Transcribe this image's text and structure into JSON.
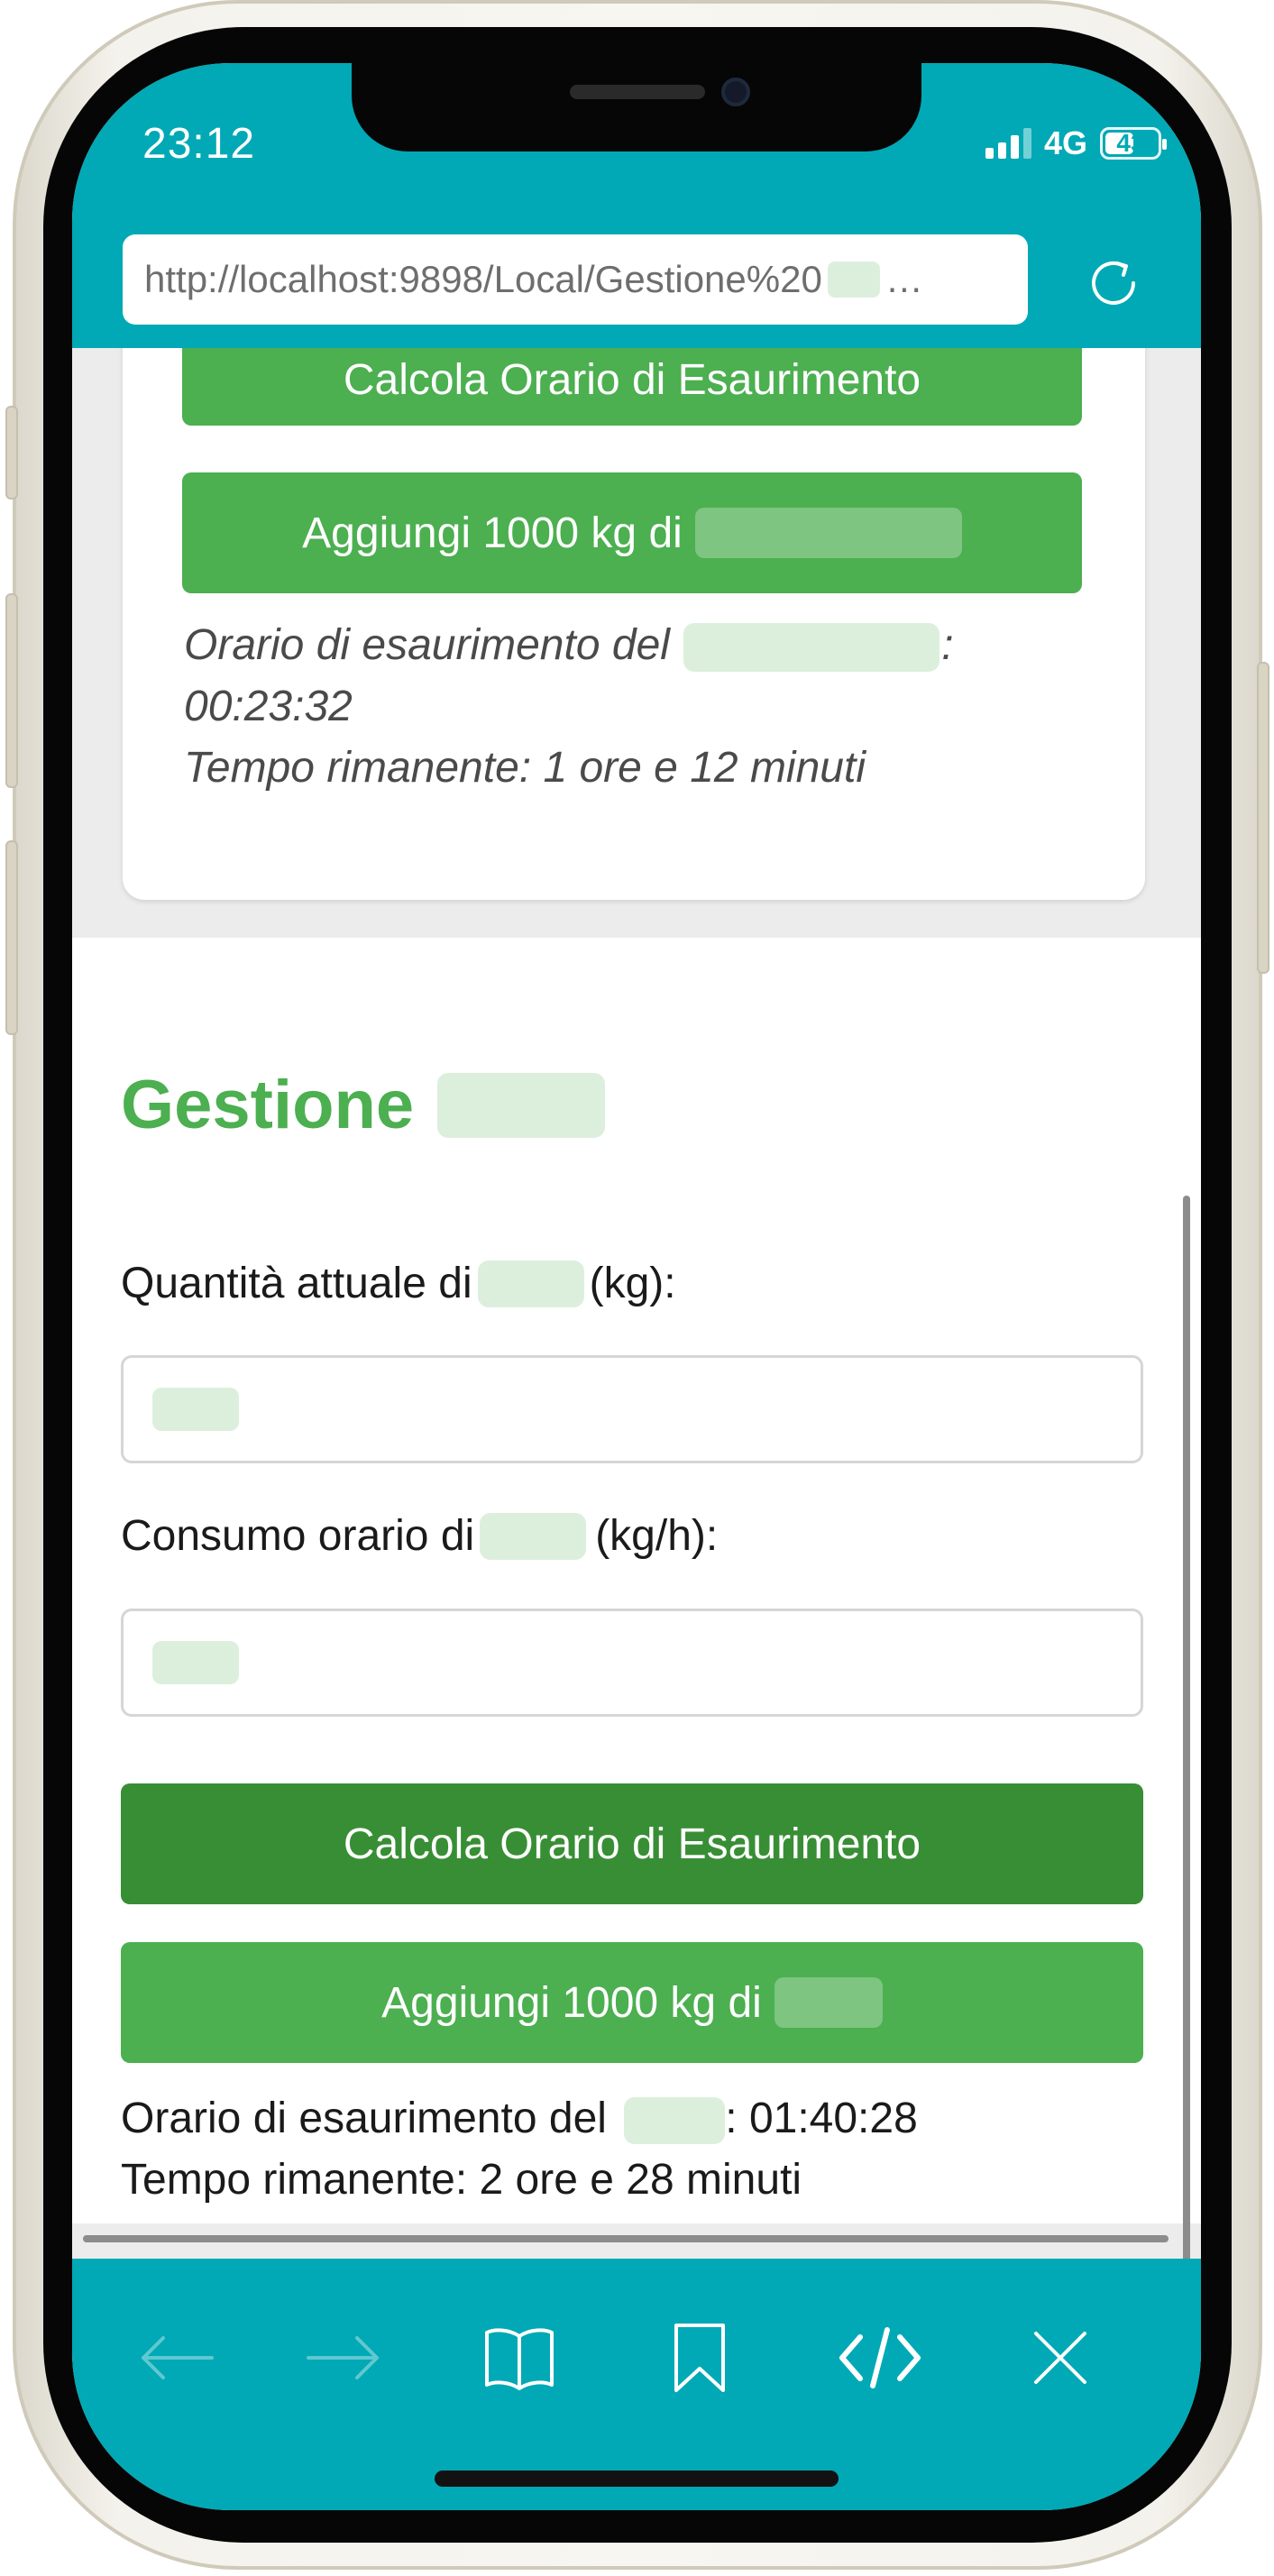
{
  "status_bar": {
    "time": "23:12",
    "network": "4G",
    "battery_level": "43"
  },
  "browser": {
    "url": "http://localhost:9898/Local/Gestione%20",
    "url_ellipsis": "…"
  },
  "section1": {
    "calc_button_label": "Calcola Orario di Esaurimento",
    "add_button_label": "Aggiungi 1000 kg di",
    "result_line1_prefix": "Orario di esaurimento del",
    "result_line1_suffix": ":",
    "result_time": "00:23:32",
    "result_line2": "Tempo rimanente: 1 ore e 12 minuti"
  },
  "section2": {
    "title": "Gestione",
    "quantity_label_prefix": "Quantità attuale di",
    "quantity_label_suffix": "(kg):",
    "consumption_label_prefix": "Consumo orario di",
    "consumption_label_suffix": "(kg/h):",
    "calc_button_label": "Calcola Orario di Esaurimento",
    "add_button_label": "Aggiungi 1000 kg di",
    "result_line1_prefix": "Orario di esaurimento del",
    "result_line1_suffix": ": 01:40:28",
    "result_line2": "Tempo rimanente: 2 ore e 28 minuti"
  },
  "toolbar": {
    "icons": [
      "back-arrow-icon",
      "forward-arrow-icon",
      "book-icon",
      "bookmark-icon",
      "code-icon",
      "close-icon"
    ]
  },
  "colors": {
    "teal": "#00a9b5",
    "green": "#4caf50",
    "dark_green": "#388e34",
    "redaction": "#dcefdc"
  }
}
